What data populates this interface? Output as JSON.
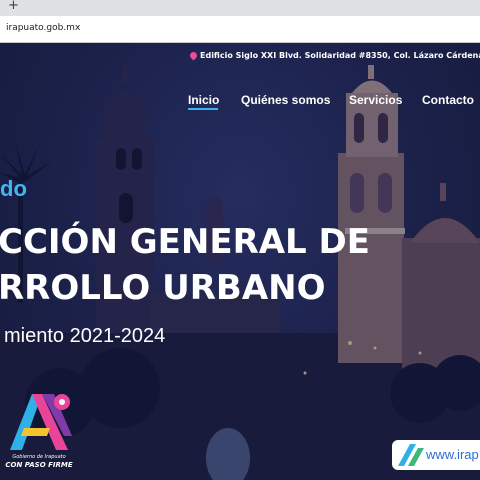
{
  "browser": {
    "new_tab_glyph": "+",
    "url": "irapuato.gob.mx"
  },
  "header": {
    "address_icon": "location-pin-icon",
    "address": "Edificio Siglo XXI Blvd. Solidaridad #8350, Col. Lázaro Cárdena",
    "nav": [
      {
        "label": "Inicio",
        "active": true
      },
      {
        "label": "Quiénes somos"
      },
      {
        "label": "Servicios"
      },
      {
        "label": "Contacto"
      }
    ]
  },
  "hero": {
    "welcome": "do",
    "title_line1": "CCIÓN GENERAL DE",
    "title_line2": "RROLLO URBANO",
    "period": "miento 2021-2024"
  },
  "footer": {
    "logo_line1": "Gobierno de Irapuato",
    "logo_line2": "CON PASO FIRME",
    "website": "www.irap"
  },
  "colors": {
    "accent": "#45b5f0",
    "pin": "#e84d9a",
    "background": "#1b1f3a"
  }
}
